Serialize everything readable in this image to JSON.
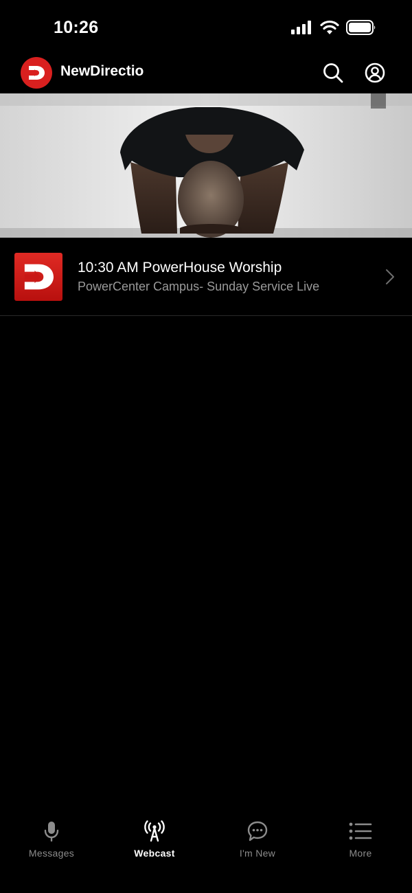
{
  "status_bar": {
    "time": "10:26",
    "icons": [
      "cellular-signal-icon",
      "wifi-icon",
      "battery-icon"
    ]
  },
  "header": {
    "title": "NewDirectio",
    "logo": "newdirection-logo-icon",
    "actions": [
      "search-icon",
      "profile-icon"
    ],
    "brand_color": "#d9201f"
  },
  "hero": {
    "description": "kneeling-person-photo"
  },
  "list": {
    "items": [
      {
        "title": "10:30 AM PowerHouse Worship",
        "subtitle": "PowerCenter Campus- Sunday Service Live",
        "icon": "newdirection-logo-icon"
      }
    ]
  },
  "tab_bar": {
    "tabs": [
      {
        "label": "Messages",
        "icon": "microphone-icon",
        "active": false
      },
      {
        "label": "Webcast",
        "icon": "broadcast-icon",
        "active": true
      },
      {
        "label": "I'm New",
        "icon": "chat-bubble-icon",
        "active": false
      },
      {
        "label": "More",
        "icon": "list-icon",
        "active": false
      }
    ]
  }
}
